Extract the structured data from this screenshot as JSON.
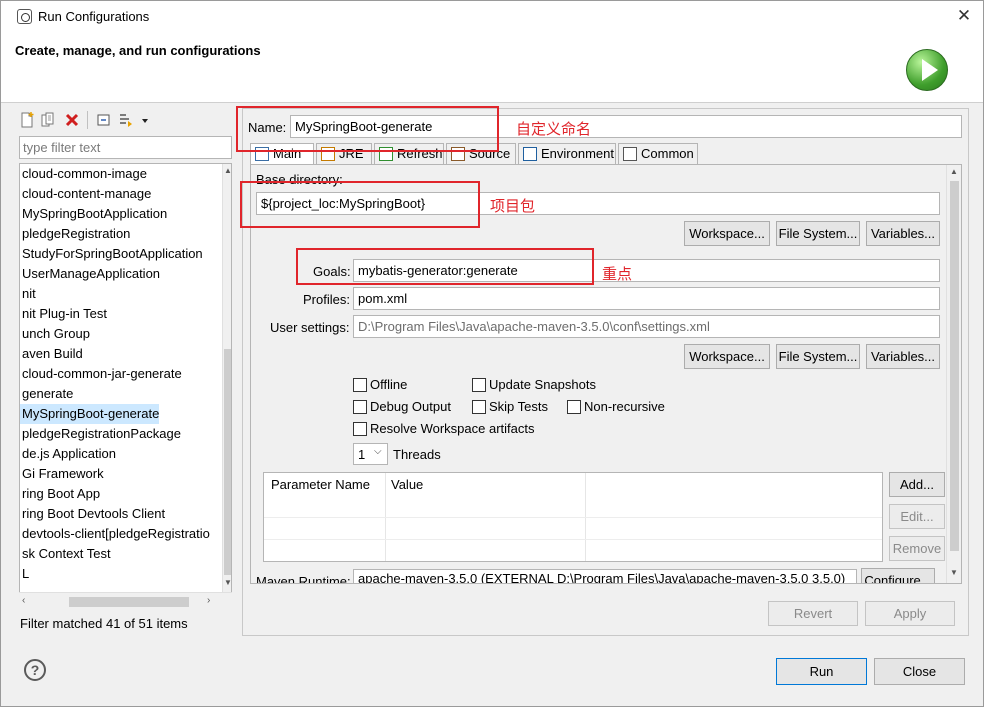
{
  "window": {
    "title": "Run Configurations",
    "close_glyph": "✕"
  },
  "banner": {
    "title": "Create, manage, and run configurations",
    "icon": "run-icon"
  },
  "left": {
    "toolbar_icons": [
      "new-config-icon",
      "duplicate-icon",
      "delete-icon",
      "collapse-all-icon",
      "filter-icon",
      "dropdown-arrow-icon"
    ],
    "filter_placeholder": "type filter text",
    "tree_items": [
      "cloud-common-image",
      "cloud-content-manage",
      "MySpringBootApplication",
      "pledgeRegistration",
      "StudyForSpringBootApplication",
      "UserManageApplication",
      "nit",
      "nit Plug-in Test",
      "unch Group",
      "aven Build",
      "cloud-common-jar-generate",
      "generate",
      "MySpringBoot-generate",
      "pledgeRegistrationPackage",
      "de.js Application",
      "Gi Framework",
      "ring Boot App",
      "ring Boot Devtools Client",
      "devtools-client[pledgeRegistratio",
      "sk Context Test",
      "L"
    ],
    "selected_index": 12,
    "status": "Filter matched 41 of 51 items"
  },
  "main": {
    "name_label": "Name:",
    "name_value": "MySpringBoot-generate",
    "tabs": [
      {
        "label": "Main",
        "icon": "main-tab-icon"
      },
      {
        "label": "JRE",
        "icon": "jre-icon"
      },
      {
        "label": "Refresh",
        "icon": "refresh-icon"
      },
      {
        "label": "Source",
        "icon": "source-icon"
      },
      {
        "label": "Environment",
        "icon": "environment-icon"
      },
      {
        "label": "Common",
        "icon": "common-icon"
      }
    ],
    "base_directory_label": "Base directory:",
    "base_directory_value": "${project_loc:MySpringBoot}",
    "workspace_btn": "Workspace...",
    "filesystem_btn": "File System...",
    "variables_btn": "Variables...",
    "goals_label": "Goals:",
    "goals_value": "mybatis-generator:generate",
    "profiles_label": "Profiles:",
    "profiles_value": "pom.xml",
    "user_settings_label": "User settings:",
    "user_settings_value": "D:\\Program Files\\Java\\apache-maven-3.5.0\\conf\\settings.xml",
    "checkboxes": {
      "offline": "Offline",
      "update_snapshots": "Update Snapshots",
      "debug_output": "Debug Output",
      "skip_tests": "Skip Tests",
      "non_recursive": "Non-recursive",
      "resolve_workspace": "Resolve Workspace artifacts"
    },
    "threads_value": "1",
    "threads_label": "Threads",
    "param_headers": [
      "Parameter Name",
      "Value"
    ],
    "add_btn": "Add...",
    "edit_btn": "Edit...",
    "remove_btn": "Remove",
    "maven_runtime_label": "Maven Runtime:",
    "maven_runtime_value": "apache-maven-3.5.0 (EXTERNAL D:\\Program Files\\Java\\apache-maven-3.5.0 3.5.0)",
    "configure_btn": "Configure...",
    "revert_btn": "Revert",
    "apply_btn": "Apply"
  },
  "annotations": {
    "name": "自定义命名",
    "base_dir": "项目包",
    "goals": "重点",
    "color": "#e0252b"
  },
  "footer": {
    "help_glyph": "?",
    "run_btn": "Run",
    "close_btn": "Close"
  }
}
